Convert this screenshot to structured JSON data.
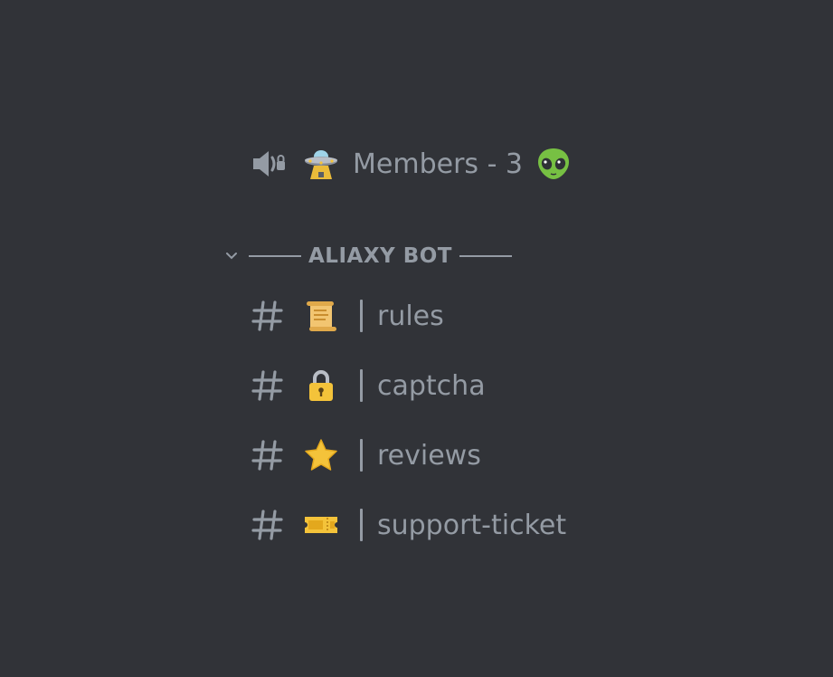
{
  "voice_channel": {
    "icon": "speaker-lock-icon",
    "emoji": "ufo-icon",
    "label": "Members - 3",
    "tail_emoji": "alien-icon"
  },
  "category": {
    "name": "ALIAXY BOT",
    "icon": "chevron-down-icon"
  },
  "channels": [
    {
      "label": "rules",
      "emoji": "scroll-icon"
    },
    {
      "label": "captcha",
      "emoji": "lock-icon"
    },
    {
      "label": "reviews",
      "emoji": "star-icon"
    },
    {
      "label": "support-ticket",
      "emoji": "ticket-icon"
    }
  ],
  "colors": {
    "background": "#313338",
    "text_muted": "#949ba4",
    "emoji_yellow": "#f4c33a",
    "alien_green": "#77c043"
  }
}
